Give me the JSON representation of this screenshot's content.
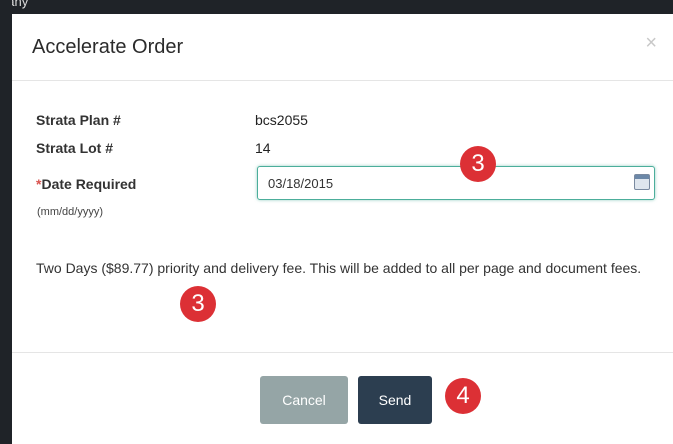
{
  "backdrop": {
    "corner_text": "pany"
  },
  "modal": {
    "title": "Accelerate Order",
    "close_glyph": "×",
    "fields": {
      "strata_plan_label": "Strata Plan #",
      "strata_plan_value": "bcs2055",
      "strata_lot_label": "Strata Lot #",
      "strata_lot_value": "14",
      "date_required_star": "*",
      "date_required_label": "Date Required",
      "date_format_hint": "(mm/dd/yyyy)",
      "date_required_value": "03/18/2015"
    },
    "fee_notice": "Two Days ($89.77) priority and delivery fee. This will be added to all per page and document fees.",
    "buttons": {
      "cancel": "Cancel",
      "send": "Send"
    }
  },
  "step_markers": [
    "3",
    "3",
    "4"
  ],
  "colors": {
    "accent_input_border": "#4cae9b",
    "cancel_button": "#95a5a6",
    "send_button": "#2c3e50",
    "marker": "#dc3035",
    "required_star": "#d9534f"
  },
  "icons": {
    "close": "close-icon",
    "calendar": "calendar-icon"
  }
}
